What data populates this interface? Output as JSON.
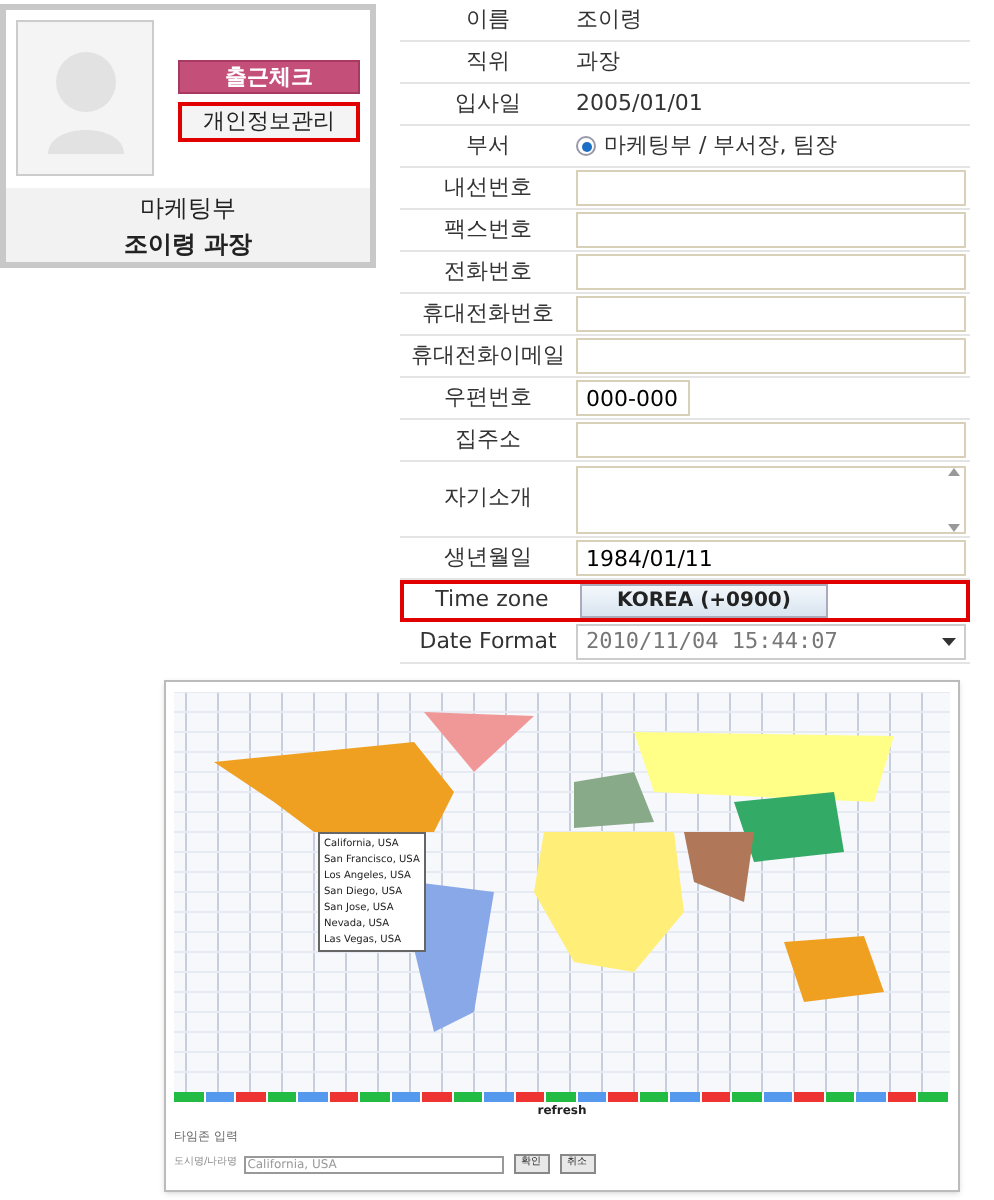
{
  "profile": {
    "checkin_button": "출근체크",
    "info_button": "개인정보관리",
    "department": "마케팅부",
    "name": "조이령 과장"
  },
  "fields": [
    {
      "kind": "text",
      "label": "이름",
      "value": "조이령"
    },
    {
      "kind": "text",
      "label": "직위",
      "value": "과장"
    },
    {
      "kind": "text",
      "label": "입사일",
      "value": "2005/01/01"
    },
    {
      "kind": "radio",
      "label": "부서",
      "value": "마케팅부 / 부서장, 팀장",
      "selected": true
    },
    {
      "kind": "input",
      "label": "내선번호"
    },
    {
      "kind": "input",
      "label": "팩스번호"
    },
    {
      "kind": "input",
      "label": "전화번호"
    },
    {
      "kind": "input",
      "label": "휴대전화번호"
    },
    {
      "kind": "input",
      "label": "휴대전화이메일"
    },
    {
      "kind": "short",
      "label": "우편번호",
      "value": "000-000"
    },
    {
      "kind": "input",
      "label": "집주소"
    },
    {
      "kind": "textarea",
      "label": "자기소개"
    },
    {
      "kind": "input",
      "label": "생년월일",
      "value": "1984/01/11"
    },
    {
      "kind": "button",
      "label": "Time zone",
      "value": "KOREA (+0900)",
      "highlighted": true
    },
    {
      "kind": "select",
      "label": "Date Format",
      "value": "2010/11/04 15:44:07"
    }
  ],
  "timezone_popup": {
    "cities": [
      "California, USA",
      "San Francisco, USA",
      "Los Angeles, USA",
      "San Diego, USA",
      "San Jose, USA",
      "Nevada, USA",
      "Las Vegas, USA"
    ],
    "refresh": "refresh",
    "form_title": "타임존 입력",
    "city_label": "도시명/나라명",
    "city_value": "California, USA",
    "buttons": [
      "확인",
      "취소"
    ]
  }
}
